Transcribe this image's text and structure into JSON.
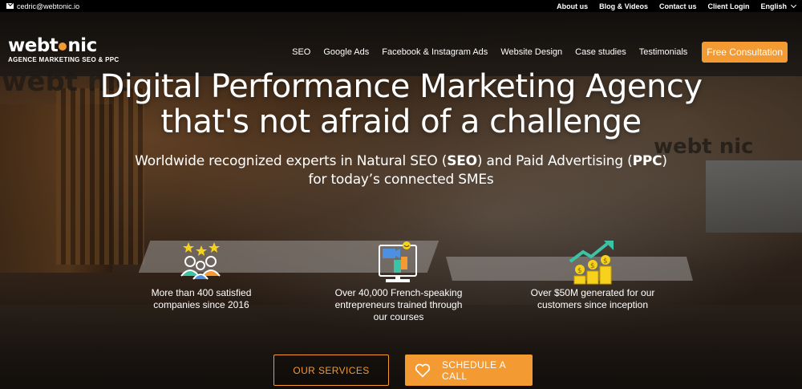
{
  "topbar": {
    "email": "cedric@webtonic.io",
    "links": [
      "About us",
      "Blog & Videos",
      "Contact us",
      "Client Login"
    ],
    "language": "English"
  },
  "logo": {
    "word_left": "webt",
    "word_right": "nic",
    "tagline": "AGENCE MARKETING SEO & PPC"
  },
  "nav": {
    "items": [
      "SEO",
      "Google Ads",
      "Facebook & Instagram Ads",
      "Website Design",
      "Case studies",
      "Testimonials"
    ],
    "cta": "Free Consultation"
  },
  "background": {
    "wall_text_left": "webt nic",
    "wall_text_right": "webt nic"
  },
  "hero": {
    "title_line1": "Digital Performance Marketing Agency",
    "title_line2": "that's not afraid of a challenge",
    "sub_part1": "Worldwide recognized experts in Natural SEO (",
    "sub_bold1": "SEO",
    "sub_part2": ") and Paid Advertising (",
    "sub_bold2": "PPC",
    "sub_part3": ")",
    "sub_line2": "for today’s connected SMEs"
  },
  "stats": [
    {
      "line1": "More than 400 satisfied",
      "line2": "companies since 2016",
      "line3": ""
    },
    {
      "line1": "Over 40,000 French-speaking",
      "line2": "entrepreneurs trained through",
      "line3": "our courses"
    },
    {
      "line1": "Over $50M generated for our",
      "line2": "customers since inception",
      "line3": ""
    }
  ],
  "buttons": {
    "services": "OUR SERVICES",
    "schedule": "SCHEDULE A CALL"
  },
  "colors": {
    "accent": "#f39a32",
    "topbar": "#000000"
  }
}
